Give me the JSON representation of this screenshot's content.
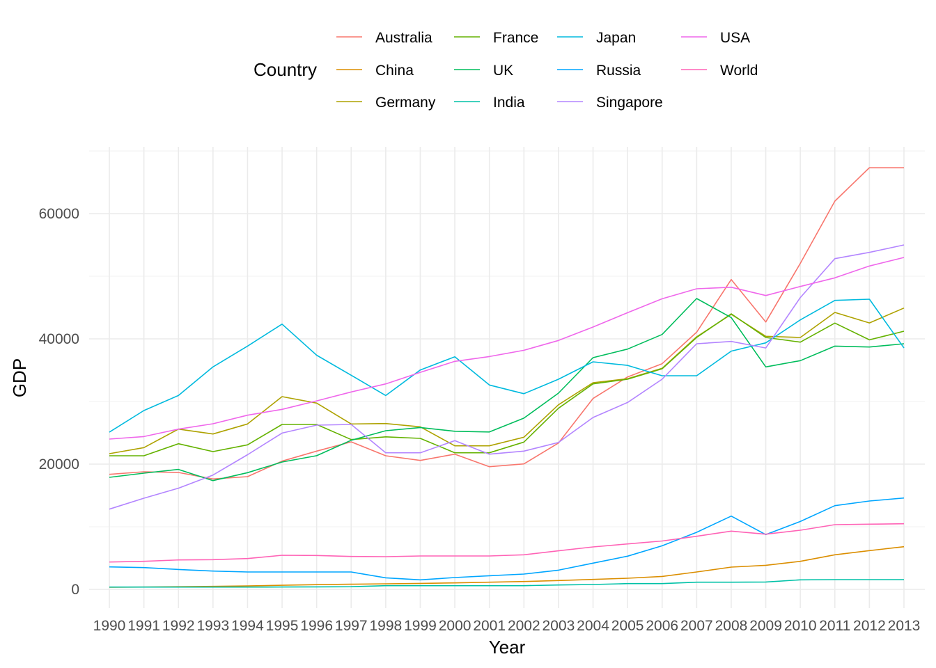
{
  "chart_data": {
    "type": "line",
    "title": "",
    "xlabel": "Year",
    "ylabel": "GDP",
    "x": [
      1990,
      1991,
      1992,
      1993,
      1994,
      1995,
      1996,
      1997,
      1998,
      1999,
      2000,
      2001,
      2002,
      2003,
      2004,
      2005,
      2006,
      2007,
      2008,
      2009,
      2010,
      2011,
      2012,
      2013
    ],
    "x_tick_labels": [
      "1990",
      "1991",
      "1992",
      "1993",
      "1994",
      "1995",
      "1996",
      "1997",
      "1998",
      "1999",
      "2000",
      "2001",
      "2002",
      "2003",
      "2004",
      "2005",
      "2006",
      "2007",
      "2008",
      "2009",
      "2010",
      "2011",
      "2012",
      "2013"
    ],
    "y_ticks": [
      0,
      20000,
      40000,
      60000
    ],
    "y_tick_labels": [
      "0",
      "20000",
      "40000",
      "60000"
    ],
    "y_minor_ticks": [
      10000,
      30000,
      50000,
      70000
    ],
    "ylim": [
      -3300,
      70700
    ],
    "grid": true,
    "legend": {
      "title": "Country",
      "placement": "top"
    },
    "series": [
      {
        "name": "Australia",
        "color": "#F8766D",
        "values": [
          18370,
          18780,
          18670,
          17630,
          18000,
          20480,
          22080,
          23550,
          21330,
          20590,
          21590,
          19590,
          20030,
          23370,
          30480,
          33920,
          36030,
          41070,
          49480,
          42700,
          52070,
          62000,
          67330,
          67330
        ]
      },
      {
        "name": "China",
        "color": "#DB8E00",
        "values": [
          350,
          370,
          420,
          480,
          540,
          660,
          760,
          820,
          890,
          960,
          1030,
          1140,
          1260,
          1410,
          1590,
          1780,
          2070,
          2780,
          3560,
          3850,
          4480,
          5520,
          6190,
          6810
        ]
      },
      {
        "name": "Germany",
        "color": "#AEA200",
        "values": [
          21670,
          22630,
          25590,
          24810,
          26410,
          30780,
          29740,
          26410,
          26480,
          25960,
          22920,
          22920,
          24300,
          29480,
          33000,
          33630,
          35300,
          40330,
          43920,
          40410,
          40220,
          44220,
          42550,
          44920
        ]
      },
      {
        "name": "France",
        "color": "#64B200",
        "values": [
          21330,
          21330,
          23260,
          22000,
          23080,
          26330,
          26330,
          23920,
          24360,
          24110,
          21810,
          21810,
          23520,
          28920,
          32810,
          33550,
          35220,
          40220,
          44000,
          40220,
          39480,
          42520,
          39850,
          41220
        ]
      },
      {
        "name": "UK",
        "color": "#00BD5C",
        "values": [
          17890,
          18560,
          19150,
          17370,
          18630,
          20330,
          21350,
          23810,
          25330,
          25850,
          25250,
          25130,
          27350,
          31330,
          37000,
          38370,
          40700,
          46440,
          43400,
          35520,
          36520,
          38850,
          38700,
          39220
        ]
      },
      {
        "name": "India",
        "color": "#00C1A7",
        "values": [
          370,
          370,
          370,
          370,
          370,
          380,
          400,
          420,
          590,
          590,
          590,
          590,
          590,
          700,
          780,
          920,
          920,
          1140,
          1140,
          1180,
          1520,
          1550,
          1550,
          1550
        ]
      },
      {
        "name": "Japan",
        "color": "#00BADE",
        "values": [
          25100,
          28560,
          30960,
          35520,
          38850,
          42360,
          37390,
          34190,
          30960,
          35030,
          37150,
          32630,
          31240,
          33550,
          36330,
          35770,
          34110,
          34110,
          38040,
          39370,
          43030,
          46140,
          46330,
          38550
        ]
      },
      {
        "name": "Russia",
        "color": "#00A6FF",
        "values": [
          3590,
          3480,
          3180,
          2920,
          2780,
          2780,
          2780,
          2780,
          1850,
          1520,
          1890,
          2180,
          2440,
          3070,
          4190,
          5300,
          6960,
          9110,
          11700,
          8740,
          10850,
          13370,
          14110,
          14590
        ]
      },
      {
        "name": "Singapore",
        "color": "#B385FF",
        "values": [
          12810,
          14550,
          16150,
          18260,
          21500,
          24960,
          26220,
          26330,
          21810,
          21810,
          23740,
          21590,
          22080,
          23460,
          27440,
          29850,
          33550,
          39220,
          39590,
          38550,
          46600,
          52810,
          53810,
          55000
        ]
      },
      {
        "name": "USA",
        "color": "#EF67EB",
        "values": [
          24000,
          24400,
          25590,
          26440,
          27810,
          28740,
          30100,
          31520,
          32810,
          34660,
          36410,
          37180,
          38180,
          39740,
          41890,
          44180,
          46400,
          48000,
          48250,
          46920,
          48370,
          49740,
          51630,
          53000
        ]
      },
      {
        "name": "World",
        "color": "#FF63B6",
        "values": [
          4370,
          4480,
          4700,
          4740,
          4920,
          5440,
          5410,
          5260,
          5220,
          5330,
          5330,
          5330,
          5520,
          6150,
          6780,
          7260,
          7720,
          8480,
          9300,
          8810,
          9440,
          10330,
          10410,
          10480
        ]
      }
    ]
  }
}
